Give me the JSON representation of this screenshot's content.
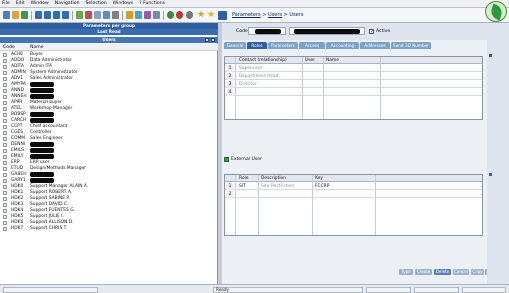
{
  "menu": [
    "File",
    "Edit",
    "Window",
    "Navigation",
    "Selection",
    "Windows",
    "? Functions"
  ],
  "breadcrumb": {
    "part1": "Parameters",
    "sep1": ">",
    "part2": "Users",
    "sep2": ">",
    "part3": "Users"
  },
  "left_panel": {
    "bar1": "Parameters per group",
    "bar2": "Last Read",
    "bar3": "Users",
    "headers": {
      "code": "Code",
      "name": "Name"
    },
    "users": [
      {
        "code": "ACHE",
        "name": "Buyer"
      },
      {
        "code": "ADDO",
        "name": "Data Administrator"
      },
      {
        "code": "ADITA",
        "name": "Admin ITA"
      },
      {
        "code": "ADMIN",
        "name": "System Administrator"
      },
      {
        "code": "ADV1",
        "name": "Sales Administrator"
      },
      {
        "code": "AMYPA",
        "name": ""
      },
      {
        "code": "ANND",
        "name": ""
      },
      {
        "code": "ANNEH",
        "name": ""
      },
      {
        "code": "APPR",
        "name": "Material buyer"
      },
      {
        "code": "ATEL",
        "name": "Workshop Manager"
      },
      {
        "code": "BOBSP",
        "name": ""
      },
      {
        "code": "CARCH",
        "name": ""
      },
      {
        "code": "CCPT",
        "name": "Chief accountant"
      },
      {
        "code": "CGES",
        "name": "Controller"
      },
      {
        "code": "COMM",
        "name": "Sales Engineer"
      },
      {
        "code": "DENNI",
        "name": ""
      },
      {
        "code": "EMILS",
        "name": ""
      },
      {
        "code": "EMILY",
        "name": ""
      },
      {
        "code": "ERP",
        "name": "ERP user"
      },
      {
        "code": "ETUD",
        "name": "Design/Methods Manager"
      },
      {
        "code": "GABEH",
        "name": ""
      },
      {
        "code": "GARY1",
        "name": ""
      },
      {
        "code": "HDK0",
        "name": "Support Manager ALAIN A."
      },
      {
        "code": "HDK1",
        "name": "Support ROBERT A."
      },
      {
        "code": "HDK2",
        "name": "Support SABINE P."
      },
      {
        "code": "HDK3",
        "name": "Support DAVID C."
      },
      {
        "code": "HDK4",
        "name": "Support FUENTES G."
      },
      {
        "code": "HDK5",
        "name": "Support JULIE I."
      },
      {
        "code": "HDK6",
        "name": "Support ALLISON D."
      },
      {
        "code": "HDK7",
        "name": "Support CHRIS T."
      }
    ]
  },
  "detail": {
    "code_label": "Code",
    "active_label": "Active",
    "tabs": [
      "General",
      "Roles",
      "Parameters",
      "Access",
      "Accounting",
      "Addresses",
      "Send 3D Number"
    ],
    "active_tab": 1,
    "contacts_grid": {
      "headers": [
        "Contact (relationship)",
        "User",
        "Name"
      ],
      "rows": [
        {
          "num": "1",
          "contact": "Supervisor"
        },
        {
          "num": "2",
          "contact": "Department Head"
        },
        {
          "num": "3",
          "contact": "Director"
        },
        {
          "num": "4",
          "contact": ""
        }
      ]
    },
    "external_user_label": "External User",
    "roles_grid": {
      "headers": [
        "Role",
        "Description",
        "Key"
      ],
      "rows": [
        {
          "num": "1",
          "role": "SIT",
          "description": "Site Restriction",
          "key": "FCCRP"
        },
        {
          "num": "2",
          "role": "",
          "description": "",
          "key": ""
        }
      ]
    },
    "buttons": [
      "Type",
      "Create",
      "Delete",
      "Cancel",
      "Copy",
      "Exit"
    ]
  },
  "status": {
    "text": "Ready"
  },
  "colors": {
    "accent": "#2e5fa3",
    "header_bar": "#2f5f9e",
    "logo_green": "#2c9a3c"
  }
}
